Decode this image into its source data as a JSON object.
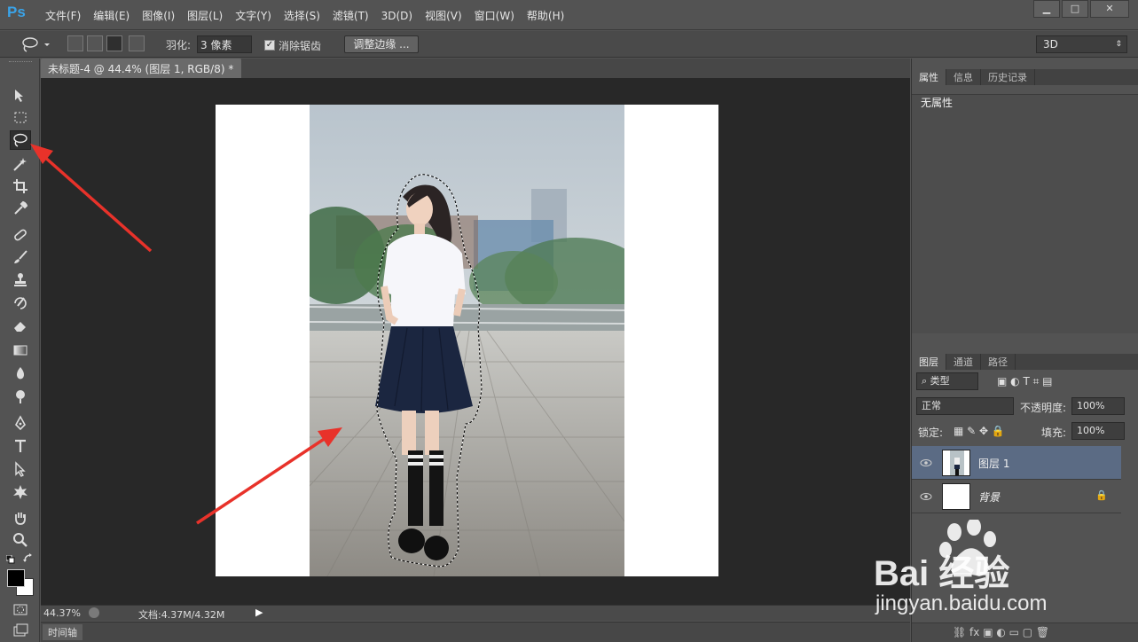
{
  "app": {
    "logo": "Ps"
  },
  "menu": [
    "文件(F)",
    "编辑(E)",
    "图像(I)",
    "图层(L)",
    "文字(Y)",
    "选择(S)",
    "滤镜(T)",
    "3D(D)",
    "视图(V)",
    "窗口(W)",
    "帮助(H)"
  ],
  "window_controls": {
    "minimize": "▁",
    "maximize": "□",
    "close": "✕"
  },
  "options": {
    "feather_label": "羽化:",
    "feather_value": "3 像素",
    "antialias_label": "消除锯齿",
    "antialias_checked": true,
    "refine_edge": "调整边缘 ...",
    "workspace": "3D"
  },
  "document": {
    "tab_title": "未标题-4 @ 44.4% (图层 1, RGB/8) *",
    "tab_close": "×"
  },
  "status": {
    "zoom": "44.37%",
    "docsize": "文档:4.37M/4.32M",
    "timeline": "时间轴"
  },
  "properties_panel": {
    "tabs": [
      "属性",
      "信息",
      "历史记录"
    ],
    "content": "无属性"
  },
  "layers_panel": {
    "tabs": [
      "图层",
      "通道",
      "路径"
    ],
    "filter_kind": "类型",
    "blend_mode": "正常",
    "opacity_label": "不透明度:",
    "opacity_value": "100%",
    "lock_label": "锁定:",
    "fill_label": "填充:",
    "fill_value": "100%",
    "layers": [
      {
        "name": "图层 1",
        "selected": true,
        "visible": true
      },
      {
        "name": "背景",
        "selected": false,
        "visible": true,
        "locked": true
      }
    ]
  },
  "watermark": {
    "brand": "Bai  经验",
    "url": "jingyan.baidu.com"
  },
  "colors": {
    "accent": "#3aa3e8",
    "arrow": "#e8322a",
    "selection": "#5b6b84"
  },
  "tools": [
    "move-tool",
    "marquee-tool",
    "lasso-tool",
    "magic-wand-tool",
    "crop-tool",
    "eyedropper-tool",
    "healing-tool",
    "brush-tool",
    "stamp-tool",
    "history-brush-tool",
    "eraser-tool",
    "gradient-tool",
    "blur-tool",
    "dodge-tool",
    "pen-tool",
    "type-tool",
    "path-select-tool",
    "shape-tool",
    "hand-tool",
    "zoom-tool"
  ],
  "active_tool": "lasso-tool"
}
